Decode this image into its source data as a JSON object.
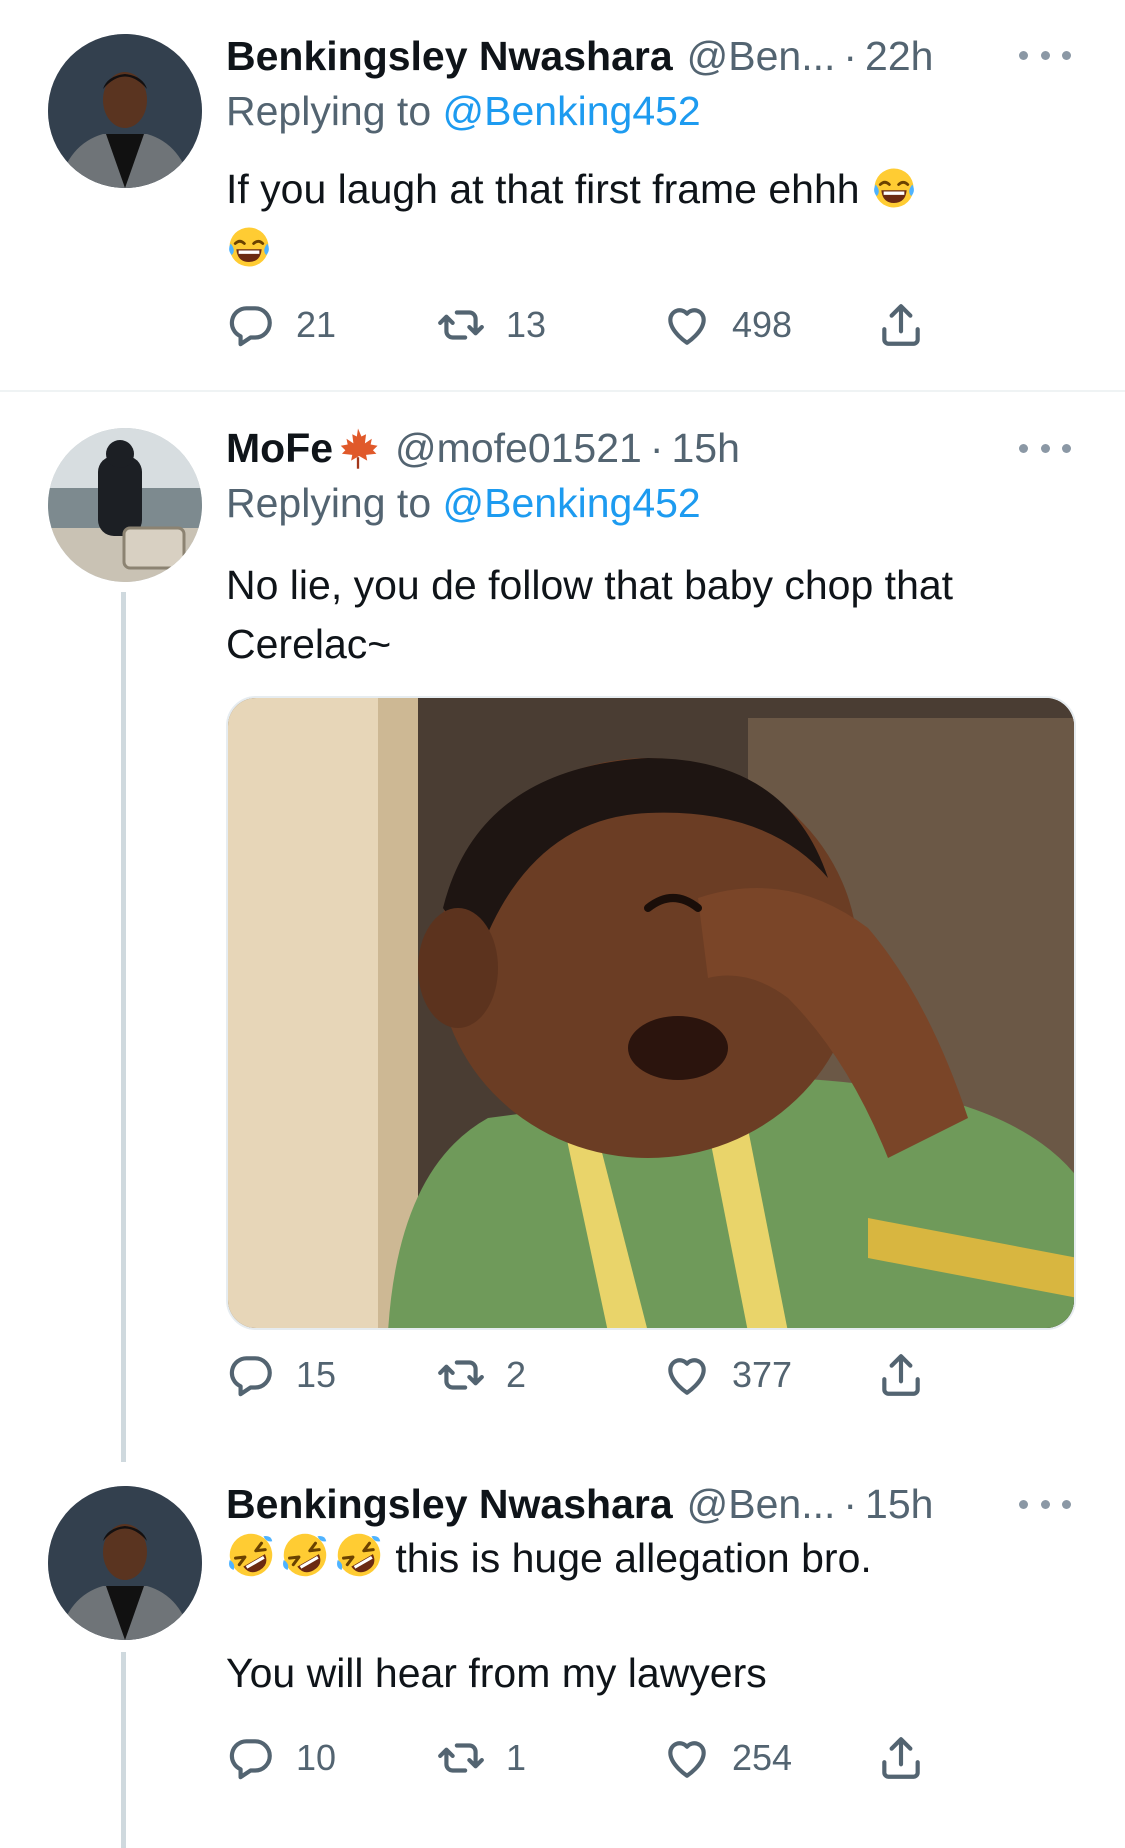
{
  "tweets": [
    {
      "name": "Benkingsley Nwashara",
      "handle": "@Ben...",
      "dot": "·",
      "time": "22h",
      "replying_prefix": "Replying to",
      "replying_to": "@Benking452",
      "text": "If you laugh at that first frame ehhh",
      "emoji_suffix": [
        "face-with-tears-of-joy",
        "face-with-tears-of-joy"
      ],
      "replies": "21",
      "retweets": "13",
      "likes": "498"
    },
    {
      "name": "MoFe",
      "name_emoji": "maple-leaf",
      "handle": "@mofe01521",
      "dot": "·",
      "time": "15h",
      "replying_prefix": "Replying to",
      "replying_to": "@Benking452",
      "text": "No lie, you de follow that baby chop that Cerelac~",
      "media": "photo-child-laughing-covering-nose",
      "replies": "15",
      "retweets": "2",
      "likes": "377"
    },
    {
      "name": "Benkingsley Nwashara",
      "handle": "@Ben...",
      "dot": "·",
      "time": "15h",
      "emoji_prefix": [
        "rolling-on-floor-laughing",
        "rolling-on-floor-laughing",
        "rolling-on-floor-laughing"
      ],
      "text_line1": "this is huge allegation bro.",
      "text_line2": "You will hear from my lawyers",
      "replies": "10",
      "retweets": "1",
      "likes": "254"
    }
  ],
  "colors": {
    "text": "#0f1419",
    "secondary": "#536471",
    "link": "#1d9bf0",
    "divider": "#eff3f4"
  }
}
